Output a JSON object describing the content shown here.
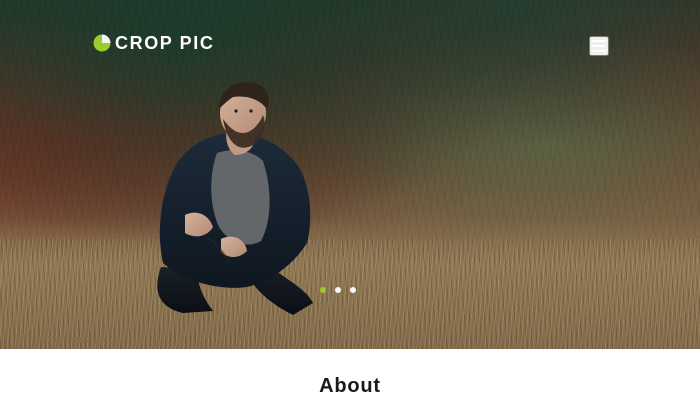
{
  "header": {
    "brand": "CROP PIC",
    "menu_icon": "hamburger-menu-icon"
  },
  "hero": {
    "slide_indicators": [
      {
        "state": "active"
      },
      {
        "state": "inactive"
      },
      {
        "state": "inactive"
      }
    ],
    "colors": {
      "accent": "#9ccc2b"
    }
  },
  "about": {
    "title": "About"
  }
}
